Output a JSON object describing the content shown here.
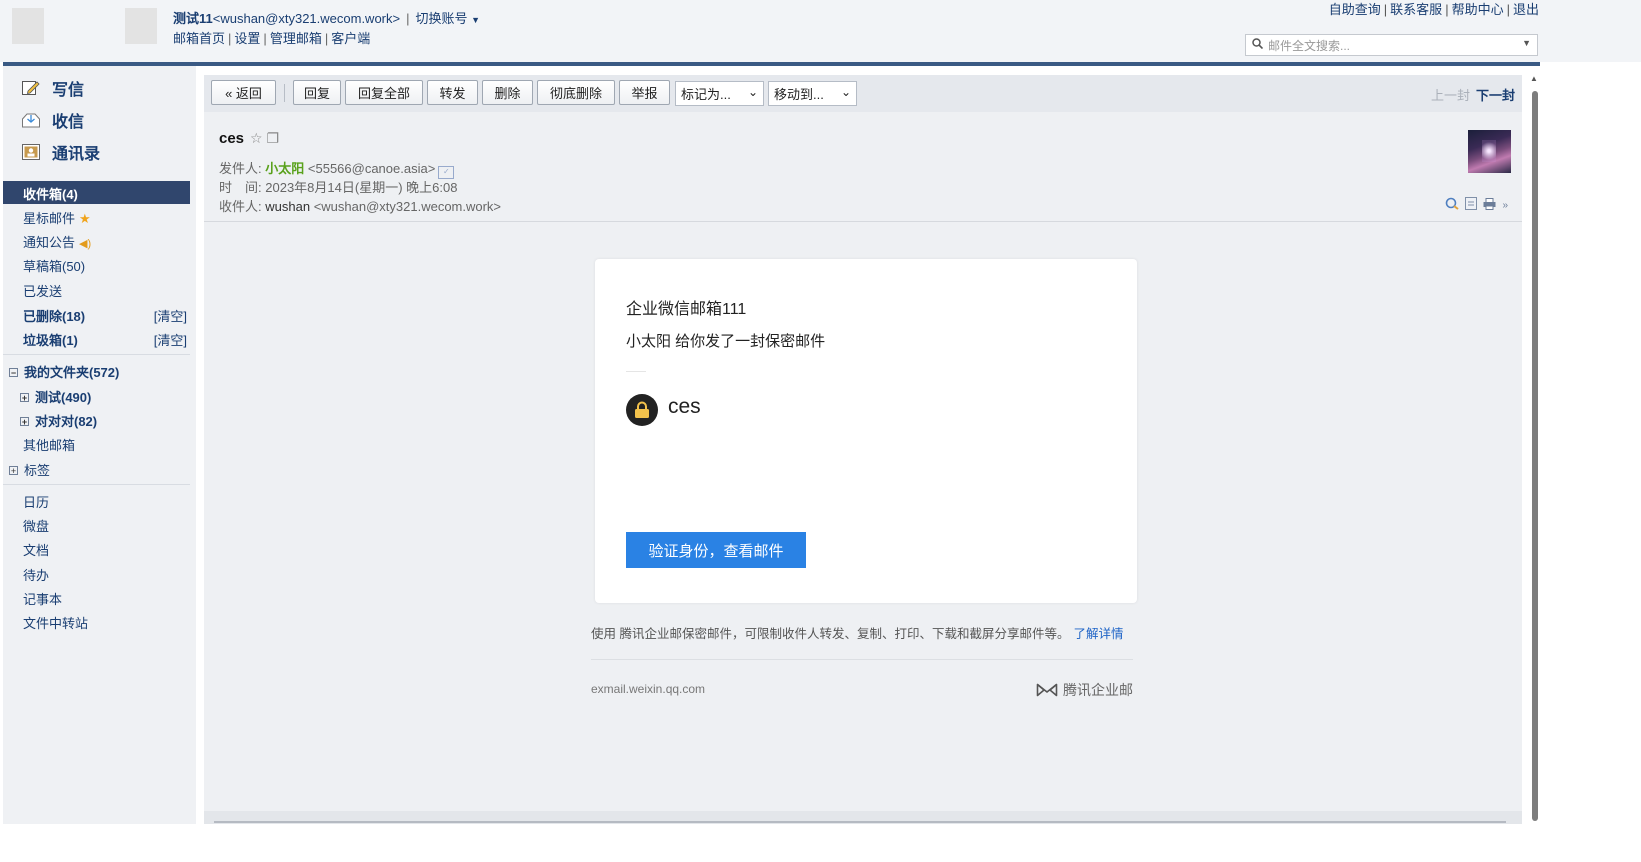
{
  "header": {
    "account_name": "测试11",
    "account_email": "<wushan@xty321.wecom.work>",
    "separator": "|",
    "switch_label": "切换账号",
    "nav": [
      "邮箱首页",
      "设置",
      "管理邮箱",
      "客户端"
    ],
    "top_links": [
      "自助查询",
      "联系客服",
      "帮助中心",
      "退出"
    ],
    "search_placeholder": "邮件全文搜索..."
  },
  "sidebar": {
    "compose": "写信",
    "receive": "收信",
    "contacts": "通讯录",
    "inbox": "收件箱(4)",
    "starred": "星标邮件",
    "notices": "通知公告",
    "drafts": "草稿箱(50)",
    "sent": "已发送",
    "deleted": "已删除(18)",
    "spam": "垃圾箱(1)",
    "clear_label": "[清空]",
    "my_folders": "我的文件夹(572)",
    "folder_test": "测试(490)",
    "folder_duidui": "对对对(82)",
    "other_mail": "其他邮箱",
    "tags": "标签",
    "tools": [
      "日历",
      "微盘",
      "文档",
      "待办",
      "记事本",
      "文件中转站"
    ]
  },
  "toolbar": {
    "back": "« 返回",
    "reply": "回复",
    "reply_all": "回复全部",
    "forward": "转发",
    "delete": "删除",
    "delete_forever": "彻底删除",
    "report": "举报",
    "mark_as": "标记为...",
    "move_to": "移动到...",
    "prev": "上一封",
    "next": "下一封"
  },
  "mail": {
    "subject": "ces",
    "from_label": "发件人:",
    "from_name": "小太阳",
    "from_addr": "<55566@canoe.asia>",
    "time_label": "时　间:",
    "time_value": "2023年8月14日(星期一) 晚上6:08",
    "to_label": "收件人:",
    "to_name": "wushan",
    "to_addr": "<wushan@xty321.wecom.work>"
  },
  "card": {
    "title": "企业微信邮箱111",
    "subtitle": "小太阳 给你发了一封保密邮件",
    "secret_subject": "ces",
    "verify_button": "验证身份，查看邮件",
    "footnote": "使用 腾讯企业邮保密邮件，可限制收件人转发、复制、打印、下载和截屏分享邮件等。",
    "learn_more": "了解详情",
    "domain": "exmail.weixin.qq.com",
    "brand": "腾讯企业邮"
  },
  "colors": {
    "header_line": "#3a5a84",
    "active_folder": "#30466d",
    "link": "#1a3e72",
    "sender_green": "#59a11b",
    "verify_blue": "#2a82e4"
  }
}
